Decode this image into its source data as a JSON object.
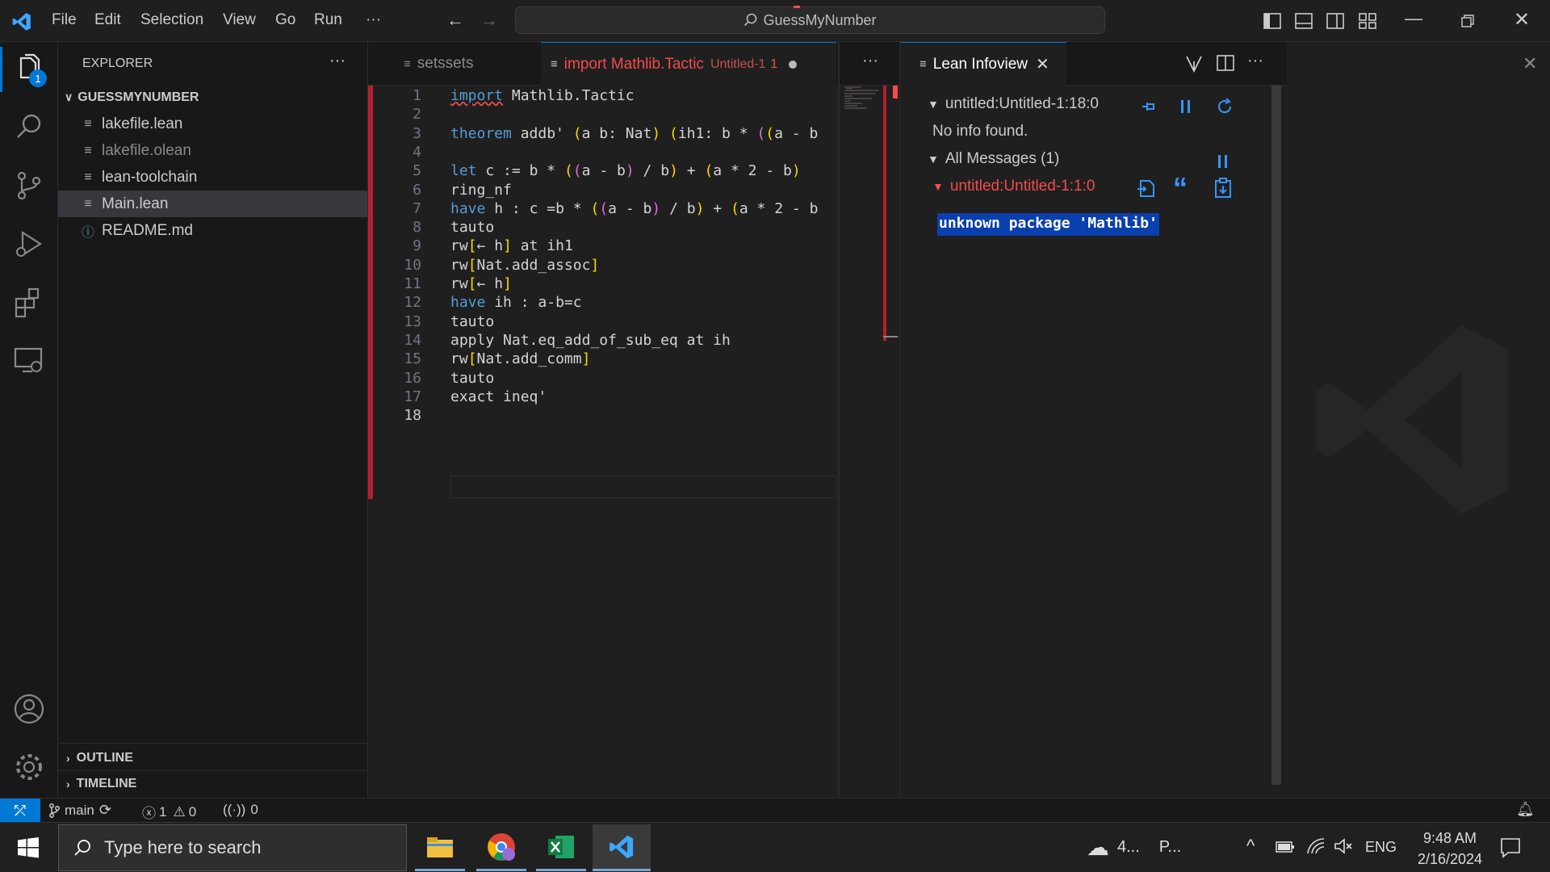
{
  "titlebar": {
    "menu": [
      "File",
      "Edit",
      "Selection",
      "View",
      "Go",
      "Run",
      "···"
    ],
    "search_text": "GuessMyNumber"
  },
  "activity": {
    "explorer_badge": "1"
  },
  "sidebar": {
    "title": "EXPLORER",
    "more": "···",
    "folder": "GUESSMYNUMBER",
    "files": [
      {
        "name": "lakefile.lean",
        "glyph": "≡"
      },
      {
        "name": "lakefile.olean",
        "glyph": "≡"
      },
      {
        "name": "lean-toolchain",
        "glyph": "≡"
      },
      {
        "name": "Main.lean",
        "glyph": "≡"
      },
      {
        "name": "README.md",
        "glyph": "ⓘ"
      }
    ],
    "outline": "OUTLINE",
    "timeline": "TIMELINE"
  },
  "editor": {
    "tabs": [
      {
        "label": "setssets",
        "glyph": "≡"
      },
      {
        "label": "import Mathlib.Tactic",
        "sub": "Untitled-1",
        "count": "1",
        "glyph": "≡"
      }
    ],
    "more": "···",
    "lines": [
      {
        "n": "1",
        "t": "import Mathlib.Tactic"
      },
      {
        "n": "2",
        "t": ""
      },
      {
        "n": "3",
        "t": "theorem addb' (a b: Nat) (ih1: b * ((a - b"
      },
      {
        "n": "4",
        "t": ""
      },
      {
        "n": "5",
        "t": "let c := b * ((a - b) / b) + (a * 2 - b)"
      },
      {
        "n": "6",
        "t": "ring_nf"
      },
      {
        "n": "7",
        "t": "have h : c =b * ((a - b) / b) + (a * 2 - b"
      },
      {
        "n": "8",
        "t": "tauto"
      },
      {
        "n": "9",
        "t": "rw[← h] at ih1"
      },
      {
        "n": "10",
        "t": "rw[Nat.add_assoc]"
      },
      {
        "n": "11",
        "t": "rw[← h]"
      },
      {
        "n": "12",
        "t": "have ih : a-b=c"
      },
      {
        "n": "13",
        "t": "tauto"
      },
      {
        "n": "14",
        "t": "apply Nat.eq_add_of_sub_eq at ih"
      },
      {
        "n": "15",
        "t": "rw[Nat.add_comm]"
      },
      {
        "n": "16",
        "t": "tauto"
      },
      {
        "n": "17",
        "t": "exact ineq'"
      },
      {
        "n": "18",
        "t": ""
      }
    ]
  },
  "infoview": {
    "tab_label": "Lean Infoview",
    "more": "···",
    "goal_loc": "untitled:Untitled-1:18:0",
    "no_info": "No info found.",
    "all_messages": "All Messages (1)",
    "msg_loc": "untitled:Untitled-1:1:0",
    "error_text": "unknown package 'Mathlib'"
  },
  "statusbar": {
    "branch": "main",
    "errors": "1",
    "warnings": "0",
    "ports": "0"
  },
  "taskbar": {
    "search_placeholder": "Type here to search",
    "weather": "4...",
    "weather2": "P...",
    "lang": "ENG",
    "time": "9:48 AM",
    "date": "2/16/2024"
  },
  "colors": {
    "accent": "#0078d4",
    "error": "#f14c4c",
    "selection": "#264f78"
  }
}
